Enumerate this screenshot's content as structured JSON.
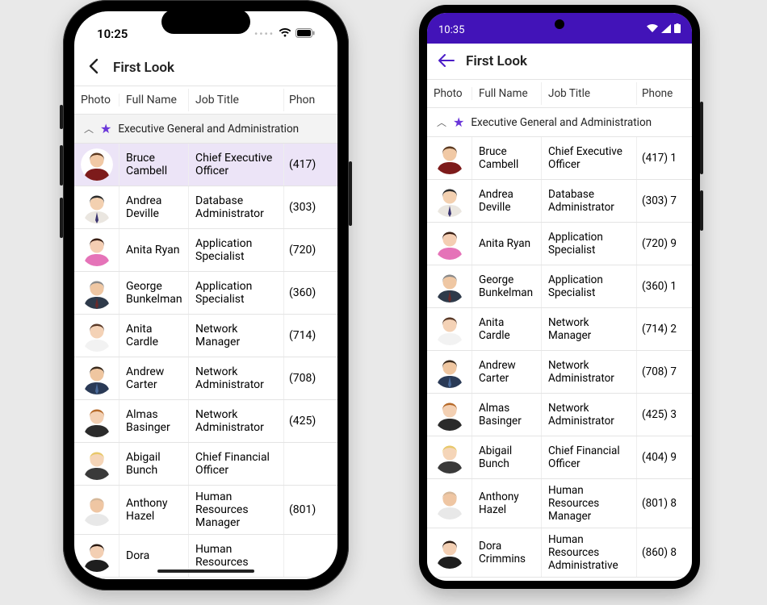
{
  "ios": {
    "status": {
      "time": "10:25"
    },
    "nav": {
      "title": "First Look"
    },
    "columns": {
      "photo": "Photo",
      "name": "Full Name",
      "title": "Job Title",
      "phone": "Phon"
    },
    "group": {
      "label": "Executive General and Administration"
    },
    "rows": [
      {
        "name": "Bruce Cambell",
        "title": "Chief Executive Officer",
        "phone": "(417)",
        "selected": true,
        "hair": "#5c3a20",
        "coat": "#7d1b1b",
        "skin": "#f1c9a5"
      },
      {
        "name": "Andrea Deville",
        "title": "Database Administrator",
        "phone": "(303)",
        "hair": "#2b2b2b",
        "coat": "#eae6e0",
        "skin": "#f3d0b0",
        "tie": "#3a3470"
      },
      {
        "name": "Anita Ryan",
        "title": "Application Specialist",
        "phone": "(720)",
        "hair": "#3a1f14",
        "coat": "#e573b8",
        "skin": "#f4ceb3"
      },
      {
        "name": "George Bunkelman",
        "title": "Application Specialist",
        "phone": "(360)",
        "hair": "#8a8a8a",
        "coat": "#2e3a4a",
        "skin": "#efc7a3",
        "tie": "#6a2a2a"
      },
      {
        "name": "Anita Cardle",
        "title": "Network Manager",
        "phone": "(714)",
        "hair": "#5a3a28",
        "coat": "#f2f2f2",
        "skin": "#f4d2b6"
      },
      {
        "name": "Andrew Carter",
        "title": "Network Administrator",
        "phone": "(708)",
        "hair": "#3a2a1c",
        "coat": "#2a3a56",
        "skin": "#efc6a0",
        "tie": "#4a6a9a"
      },
      {
        "name": "Almas Basinger",
        "title": "Network Administrator",
        "phone": "(425)",
        "hair": "#b66a2a",
        "coat": "#2b2b2b",
        "skin": "#f3d0b3"
      },
      {
        "name": "Abigail Bunch",
        "title": "Chief Financial Officer",
        "phone": "",
        "hair": "#e8c86a",
        "coat": "#3a3a3a",
        "skin": "#f5d5b8"
      },
      {
        "name": "Anthony Hazel",
        "title": "Human Resources Manager",
        "phone": "(801)",
        "hair": "#d6b89a",
        "coat": "#e8e8e8",
        "skin": "#efc6a3"
      },
      {
        "name": "Dora",
        "title": "Human Resources",
        "phone": "",
        "hair": "#2a1a12",
        "coat": "#1e1e1e",
        "skin": "#f3cfb3"
      }
    ]
  },
  "android": {
    "status": {
      "time": "10:35"
    },
    "nav": {
      "title": "First Look"
    },
    "columns": {
      "photo": "Photo",
      "name": "Full Name",
      "title": "Job Title",
      "phone": "Phone"
    },
    "group": {
      "label": "Executive General and Administration"
    },
    "rows": [
      {
        "name": "Bruce Cambell",
        "title": "Chief Executive Officer",
        "phone": "(417) 1",
        "hair": "#5c3a20",
        "coat": "#7d1b1b",
        "skin": "#f1c9a5"
      },
      {
        "name": "Andrea Deville",
        "title": "Database Administrator",
        "phone": "(303) 7",
        "hair": "#2b2b2b",
        "coat": "#eae6e0",
        "skin": "#f3d0b0",
        "tie": "#3a3470"
      },
      {
        "name": "Anita Ryan",
        "title": "Application Specialist",
        "phone": "(720) 9",
        "hair": "#3a1f14",
        "coat": "#e573b8",
        "skin": "#f4ceb3"
      },
      {
        "name": "George Bunkelman",
        "title": "Application Specialist",
        "phone": "(360) 1",
        "hair": "#8a8a8a",
        "coat": "#2e3a4a",
        "skin": "#efc7a3",
        "tie": "#6a2a2a"
      },
      {
        "name": "Anita Cardle",
        "title": "Network Manager",
        "phone": "(714) 2",
        "hair": "#5a3a28",
        "coat": "#f2f2f2",
        "skin": "#f4d2b6"
      },
      {
        "name": "Andrew Carter",
        "title": "Network Administrator",
        "phone": "(708) 7",
        "hair": "#3a2a1c",
        "coat": "#2a3a56",
        "skin": "#efc6a0",
        "tie": "#4a6a9a"
      },
      {
        "name": "Almas Basinger",
        "title": "Network Administrator",
        "phone": "(425) 3",
        "hair": "#b66a2a",
        "coat": "#2b2b2b",
        "skin": "#f3d0b3"
      },
      {
        "name": "Abigail Bunch",
        "title": "Chief Financial Officer",
        "phone": "(404) 9",
        "hair": "#e8c86a",
        "coat": "#3a3a3a",
        "skin": "#f5d5b8"
      },
      {
        "name": "Anthony Hazel",
        "title": "Human Resources Manager",
        "phone": "(801) 8",
        "hair": "#d6b89a",
        "coat": "#e8e8e8",
        "skin": "#efc6a3"
      },
      {
        "name": "Dora Crimmins",
        "title": "Human Resources Administrative",
        "phone": "(860) 8",
        "hair": "#2a1a12",
        "coat": "#1e1e1e",
        "skin": "#f3cfb3"
      }
    ]
  }
}
